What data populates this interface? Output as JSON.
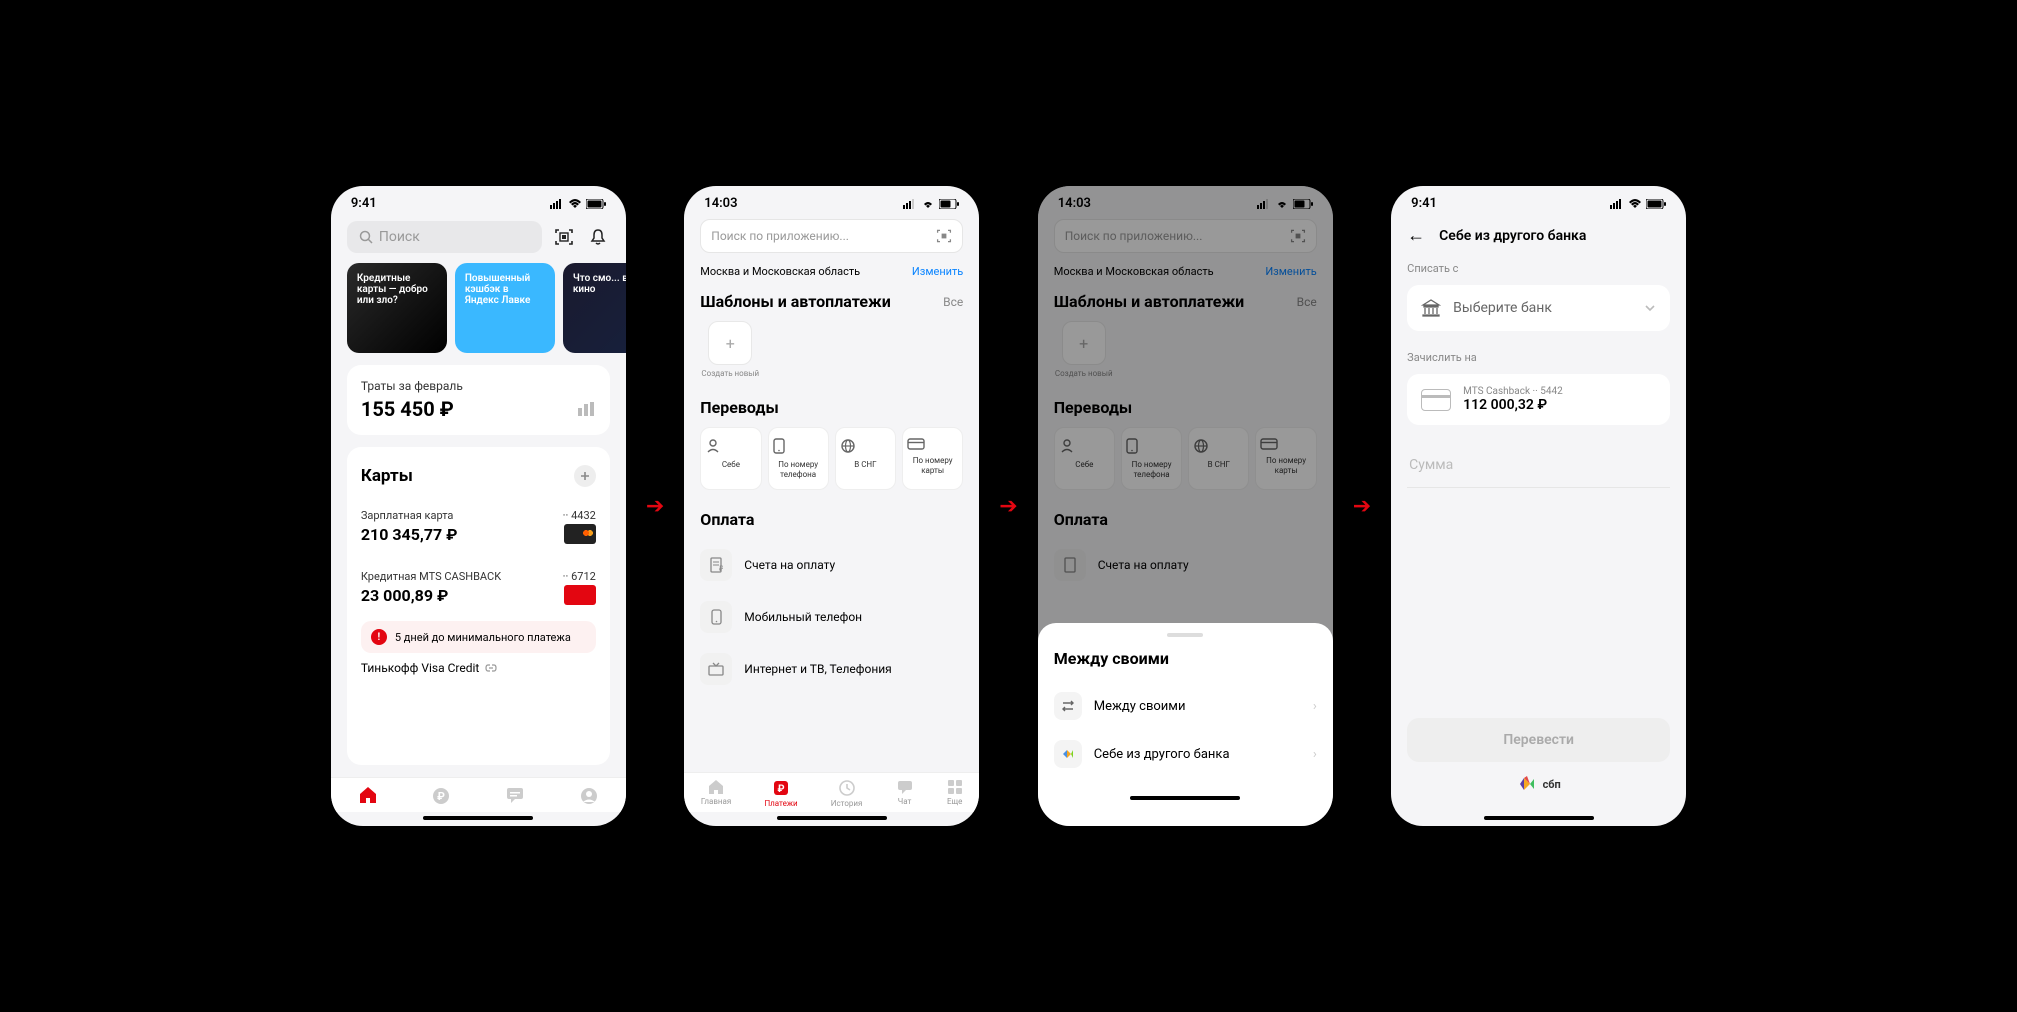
{
  "status": {
    "time_a": "9:41",
    "time_b": "14:03"
  },
  "screen1": {
    "search_placeholder": "Поиск",
    "stories": [
      {
        "text": "Кредитные карты — добро или зло?"
      },
      {
        "text": "Повышенный кэшбэк в Яндекс Лавке"
      },
      {
        "text": "Что смо... в кино"
      }
    ],
    "spend_label": "Траты за февраль",
    "spend_amount": "155 450 ₽",
    "cards_title": "Карты",
    "accounts": [
      {
        "name": "Зарплатная карта",
        "last4": "·· 4432",
        "balance": "210 345,77 ₽",
        "brand": "mc-black"
      },
      {
        "name": "Кредитная MTS CASHBACK",
        "last4": "·· 6712",
        "balance": "23 000,89 ₽",
        "brand": "mc-red"
      }
    ],
    "warning": "5 дней до минимального платежа",
    "tinkoff": "Тинькофф Visa Credit"
  },
  "screen2": {
    "search_placeholder": "Поиск по приложению...",
    "region": "Москва и Московская область",
    "region_change": "Изменить",
    "templates_title": "Шаблоны и автоплатежи",
    "all": "Все",
    "create_new": "Создать новый",
    "transfers_title": "Переводы",
    "transfer_tiles": [
      {
        "label": "Себе"
      },
      {
        "label": "По номеру телефона"
      },
      {
        "label": "В СНГ"
      },
      {
        "label": "По номеру карты"
      }
    ],
    "payment_title": "Оплата",
    "payment_items": [
      {
        "label": "Счета на оплату"
      },
      {
        "label": "Мобильный телефон"
      },
      {
        "label": "Интернет и ТВ, Телефония"
      }
    ],
    "tabs": [
      {
        "label": "Главная"
      },
      {
        "label": "Платежи"
      },
      {
        "label": "История"
      },
      {
        "label": "Чат"
      },
      {
        "label": "Еще"
      }
    ]
  },
  "screen3": {
    "sheet_title": "Между своими",
    "sheet_items": [
      {
        "label": "Между своими"
      },
      {
        "label": "Себе из другого банка"
      }
    ]
  },
  "screen4": {
    "title": "Себе из другого банка",
    "from_label": "Списать с",
    "select_bank": "Выберите банк",
    "to_label": "Зачислить на",
    "dest_name": "MTS Cashback  ·· 5442",
    "dest_balance": "112 000,32 ₽",
    "amount_placeholder": "Сумма",
    "transfer_btn": "Перевести",
    "sbp": "сбп"
  }
}
